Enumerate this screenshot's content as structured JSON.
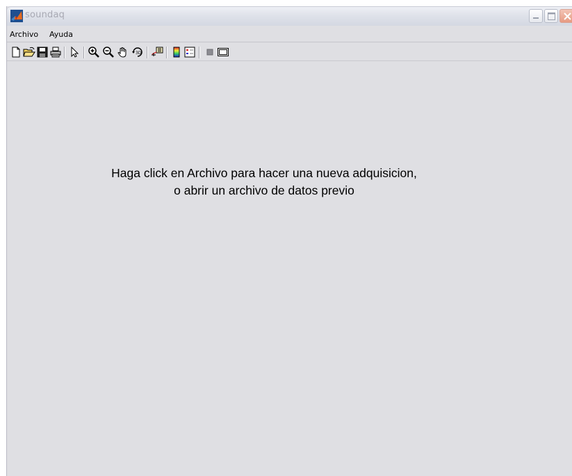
{
  "window": {
    "title": "soundaq",
    "icon": "matlab-logo-icon"
  },
  "title_buttons": [
    "minimize-icon",
    "maximize-icon",
    "close-icon"
  ],
  "menubar": {
    "items": [
      {
        "label": "Archivo"
      },
      {
        "label": "Ayuda"
      }
    ]
  },
  "toolbar": {
    "tools": [
      "new-figure-icon",
      "open-file-icon",
      "save-icon",
      "print-icon",
      "edit-plot-arrow-icon",
      "zoom-in-icon",
      "zoom-out-icon",
      "pan-hand-icon",
      "rotate-3d-icon",
      "data-cursor-icon",
      "colorbar-icon",
      "legend-icon",
      "hide-plot-tools-icon",
      "show-plot-tools-icon"
    ]
  },
  "message": {
    "line1": "Haga click en Archivo para hacer una nueva adquisicion,",
    "line2": "o abrir un archivo de datos previo"
  },
  "colors": {
    "background": "#dfdfe3",
    "title_text": "#a8a9b3"
  }
}
